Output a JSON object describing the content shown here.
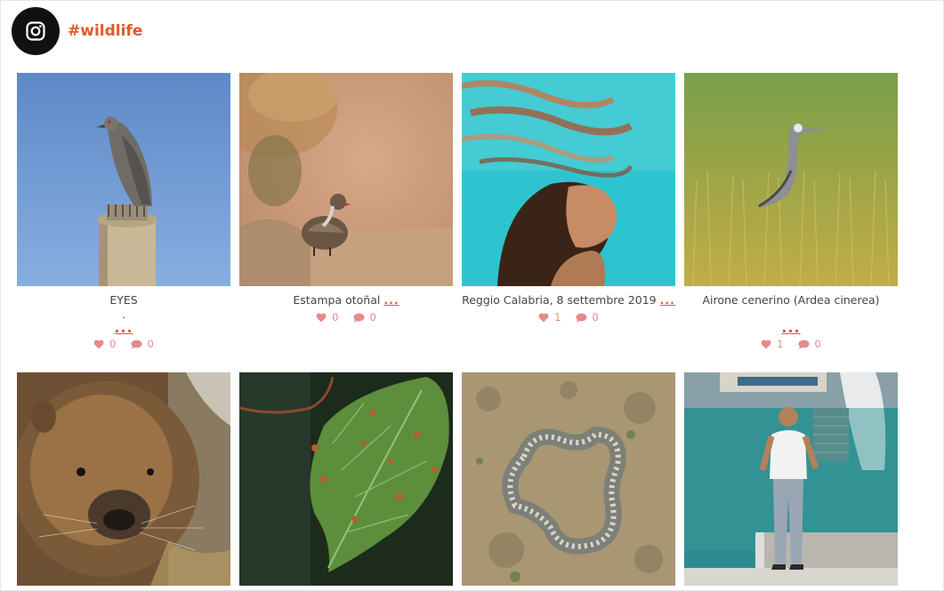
{
  "feed": {
    "hashtag": "#wildlife",
    "icon": "instagram-icon",
    "accent": "#e05a2b"
  },
  "posts": [
    {
      "caption": "EYES",
      "caption_dot": ".",
      "more": "...",
      "likes": "0",
      "comments": "0",
      "subject": "pigeon on pipe"
    },
    {
      "caption": "Estampa otoñal",
      "more": "...",
      "likes": "0",
      "comments": "0",
      "subject": "partridge"
    },
    {
      "caption": "Reggio Calabria, 8 settembre 2019",
      "more": "...",
      "likes": "1",
      "comments": "0",
      "subject": "swimmer underwater"
    },
    {
      "caption": "Airone cenerino (Ardea cinerea)",
      "more": "...",
      "likes": "1",
      "comments": "0",
      "subject": "grey heron"
    },
    {
      "subject": "nutria close-up"
    },
    {
      "subject": "galled leaf"
    },
    {
      "subject": "coral on sand"
    },
    {
      "subject": "man at harbor"
    }
  ]
}
